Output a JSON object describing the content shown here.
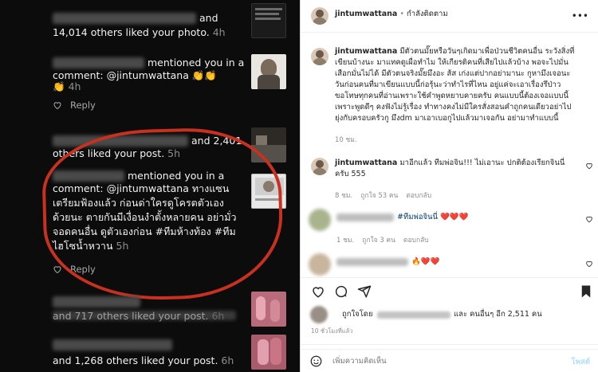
{
  "notifications": {
    "n1_text": "and",
    "n1_text2": "14,014 others liked your photo.",
    "n1_time": "4h",
    "n2_text": "mentioned you in a",
    "n2_text2": "comment: @jintumwattana",
    "n2_emoji": "👏👏",
    "n2_emoji2": "👏",
    "n2_time": "4h",
    "reply_label": "Reply",
    "n3_text": "and 2,401",
    "n3_text2": "others liked your post.",
    "n3_time": "5h",
    "n4_text": "mentioned you in a",
    "n4_line2": "comment: @jintumwattana ทางแซน",
    "n4_line3": "เตรียมฟ้องแล้ว ก่อนด่าใครดูโครตตัวเอง",
    "n4_line4": "ด้วยนะ ตายกันมีเงื่อนงำตั้งหลายคน อย่ามั่ว",
    "n4_line5": "จอดคนอื่น ดูตัวเองก่อน #ทีมห้างท้อง #ทีม",
    "n4_line6": "ไฮโซน้ำหวาน",
    "n4_time": "5h",
    "n5_text": "and 717 others liked your post.",
    "n5_time": "6h",
    "n6_text": "and 1,268 others liked your post.",
    "n6_time": "6h"
  },
  "post": {
    "header_username": "jintumwattana",
    "header_status": "กำลังติดตาม",
    "caption_username": "jintumwattana",
    "caption_lines": [
      "มีตัวตนมั๊ยหรือวันๆเกิดมาเพื่อป่วนชีวิตคนอื่น ระวังสิ่งที่",
      "เขียนบ้างนะ มาแทคดูเผื่อทำไม ให้เกียรติคนที่เสียไปแล้วบ้าง พอจะไปมั่น",
      "เสือกมั่นไม่ได้ มีตัวตนจริงมั๊ยมึงอะ ส้ส เก่งแต่ปากอย่ามานะ กูหามึงเจอนะ",
      "วันก่อนคนที่มาเขียนแบบนี้ก่อรุ้นะว่าทำไรที่ไหน อยู่แค่จะเอาเรื่องรึป่าว",
      "ขอโทษทุกคนที่อ่านเพราะใช้คำพูดหยาบคายครับ คนแบบนี้ต้องเจอแบบนี้",
      "เพราะพูดดีๆ คงฟังไม่รู้เรื่อง ทำทางคงไม่มีใครสั่งสอนคำถูกคนเดียวอย่าไป",
      "ยุ่งกับครอบครัวกู มึงdm มาเอาเบอกูไปแล้วมาเจอกัน อย่ามาทำแบบนี้"
    ],
    "caption_time": "10 ชม.",
    "reply_username": "jintumwattana",
    "reply_line1": "มาอีกแล้ว ทีมพ่อจิน!!! ไม่เอานะ ปกติต้องเรียกจินนี่",
    "reply_line2": "ครับ 555",
    "reply_time": "8 ชม.",
    "reply_likes": "ถูกใจ 53 คน",
    "reply_action": "ตอบกลับ",
    "c2_text": "#ทีมพ่อจินนี่",
    "c2_hearts": "❤️❤️❤️",
    "c2_time": "1 ชม.",
    "c2_likes": "ถูกใจ 3 คน",
    "c2_action": "ตอบกลับ",
    "c3_emojis": "🔥❤️❤️",
    "liked_by_prefix": "ถูกใจโดย",
    "liked_by_suffix": "และ คนอื่นๆ อีก 2,511 คน",
    "post_age": "10 ชั่วโมงที่แล้ว",
    "comment_placeholder": "เพิ่มความคิดเห็น",
    "post_button": "โพสต์"
  },
  "colors": {
    "annotation_red": "#c8311f",
    "ig_blue": "#0095f6",
    "link_blue": "#00376b"
  }
}
